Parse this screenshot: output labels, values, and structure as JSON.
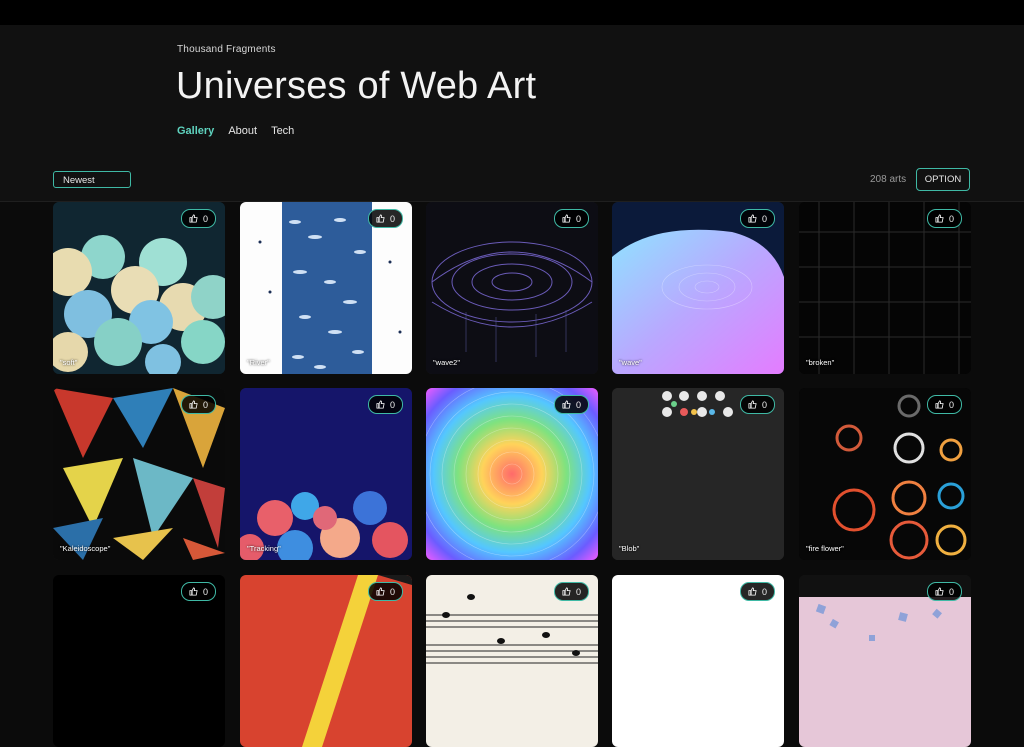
{
  "header": {
    "site_name": "Thousand Fragments",
    "title": "Universes of Web Art",
    "nav": [
      "Gallery",
      "About",
      "Tech"
    ]
  },
  "toolbar": {
    "sort": "Newest",
    "count": "208 arts",
    "option": "OPTION"
  },
  "cards": [
    {
      "label": "\"soft\"",
      "likes": "0"
    },
    {
      "label": "\"River\"",
      "likes": "0"
    },
    {
      "label": "\"wave2\"",
      "likes": "0"
    },
    {
      "label": "\"wave\"",
      "likes": "0"
    },
    {
      "label": "\"broken\"",
      "likes": "0"
    },
    {
      "label": "\"Kaleidoscope\"",
      "likes": "0"
    },
    {
      "label": "\"Tracking\"",
      "likes": "0"
    },
    {
      "label": "",
      "likes": "0"
    },
    {
      "label": "\"Blob\"",
      "likes": "0"
    },
    {
      "label": "\"fire flower\"",
      "likes": "0"
    },
    {
      "label": "",
      "likes": "0"
    },
    {
      "label": "",
      "likes": "0"
    },
    {
      "label": "",
      "likes": "0"
    },
    {
      "label": "",
      "likes": "0"
    },
    {
      "label": "",
      "likes": "0"
    }
  ],
  "icons": {
    "like": "thumbs-up-icon"
  },
  "colors": {
    "accent": "#5fd3bf",
    "border": "#3fb9a5"
  }
}
